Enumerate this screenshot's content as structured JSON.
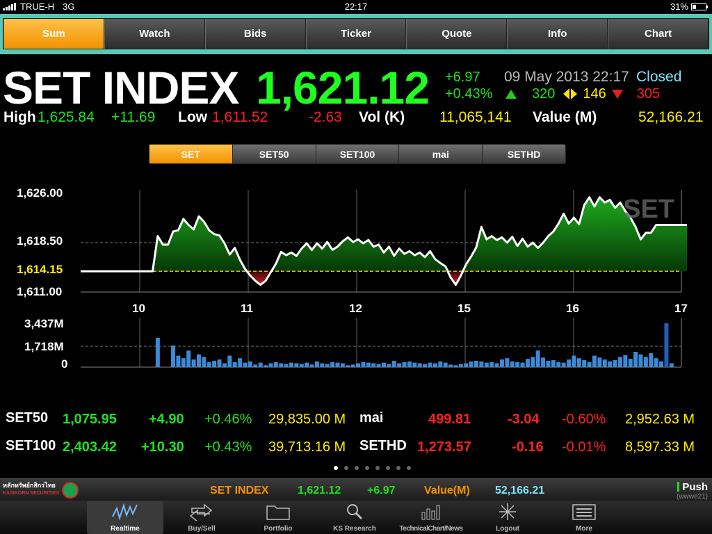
{
  "status": {
    "carrier": "TRUE-H",
    "network": "3G",
    "time": "22:17",
    "battery": "31%"
  },
  "tabs": [
    {
      "label": "Sum",
      "active": true
    },
    {
      "label": "Watch"
    },
    {
      "label": "Bids"
    },
    {
      "label": "Ticker"
    },
    {
      "label": "Quote"
    },
    {
      "label": "Info"
    },
    {
      "label": "Chart"
    }
  ],
  "header": {
    "name": "SET INDEX",
    "value": "1,621.12",
    "change": "+6.97",
    "change_pct": "+0.43%",
    "datetime": "09 May 2013 22:17",
    "market_status": "Closed",
    "advances": "320",
    "unchanged": "146",
    "declines": "305",
    "high_label": "High",
    "high": "1,625.84",
    "high_chg": "+11.69",
    "low_label": "Low",
    "low": "1,611.52",
    "low_chg": "-2.63",
    "vol_label": "Vol (K)",
    "vol": "11,065,141",
    "value_label": "Value (M)",
    "value_m": "52,166.21"
  },
  "subtabs": [
    {
      "label": "SET",
      "active": true
    },
    {
      "label": "SET50"
    },
    {
      "label": "SET100"
    },
    {
      "label": "mai"
    },
    {
      "label": "SETHD"
    }
  ],
  "chart_data": {
    "type": "line",
    "watermark": "SET",
    "y_ticks": [
      "1,626.00",
      "1,618.50",
      "1,614.15",
      "1,611.00"
    ],
    "prev_close": 1614.15,
    "ylim": [
      1611.0,
      1626.0
    ],
    "x_ticks": [
      "10",
      "11",
      "12",
      "15",
      "16",
      "17"
    ],
    "volume_ticks": [
      "3,437M",
      "1,718M",
      "0"
    ],
    "price": [
      1614.15,
      1614.15,
      1614.15,
      1614.15,
      1614.15,
      1614.15,
      1614.15,
      1614.15,
      1614.15,
      1614.15,
      1614.15,
      1614.15,
      1614.15,
      1614.15,
      1614.15,
      1619.5,
      1618.2,
      1618.2,
      1620.2,
      1620.4,
      1622.1,
      1621.2,
      1620.5,
      1622.5,
      1621.7,
      1620.4,
      1619.8,
      1619.6,
      1618.4,
      1616.7,
      1617.7,
      1615.9,
      1614.5,
      1613.5,
      1612.7,
      1612.1,
      1612.7,
      1614.0,
      1615.3,
      1617.1,
      1616.6,
      1617.0,
      1616.5,
      1617.6,
      1618.4,
      1617.4,
      1618.4,
      1617.6,
      1618.6,
      1617.4,
      1617.9,
      1618.7,
      1619.3,
      1618.6,
      1619.0,
      1618.4,
      1618.9,
      1617.9,
      1618.2,
      1617.0,
      1617.9,
      1616.5,
      1617.6,
      1616.8,
      1617.2,
      1616.6,
      1617.0,
      1616.3,
      1617.2,
      1616.0,
      1615.4,
      1614.9,
      1613.2,
      1612.1,
      1613.5,
      1615.2,
      1616.4,
      1617.8,
      1620.9,
      1619.0,
      1619.5,
      1618.9,
      1619.3,
      1618.5,
      1619.4,
      1618.0,
      1619.1,
      1617.9,
      1618.5,
      1617.7,
      1618.5,
      1619.5,
      1620.2,
      1621.4,
      1622.9,
      1621.4,
      1622.3,
      1621.3,
      1624.2,
      1625.4,
      1624.0,
      1625.4,
      1624.6,
      1625.0,
      1623.8,
      1624.6,
      1623.3,
      1622.3,
      1620.9,
      1619.0,
      1620.0,
      1620.0,
      1621.2,
      1621.2,
      1621.2,
      1621.2,
      1621.2,
      1621.2,
      1621.2
    ],
    "volume_scale": 3437,
    "volume": [
      0,
      0,
      0,
      0,
      0,
      0,
      0,
      0,
      0,
      0,
      0,
      0,
      0,
      0,
      0,
      2300,
      0,
      0,
      1700,
      900,
      700,
      1300,
      600,
      1000,
      800,
      400,
      500,
      600,
      300,
      900,
      400,
      700,
      350,
      450,
      200,
      350,
      150,
      300,
      400,
      300,
      250,
      350,
      300,
      250,
      350,
      200,
      450,
      300,
      250,
      400,
      350,
      300,
      150,
      200,
      300,
      400,
      350,
      300,
      250,
      350,
      250,
      500,
      300,
      400,
      450,
      350,
      300,
      250,
      350,
      300,
      450,
      350,
      200,
      150,
      250,
      300,
      450,
      500,
      450,
      350,
      400,
      300,
      600,
      700,
      450,
      400,
      350,
      650,
      800,
      1300,
      750,
      500,
      550,
      400,
      350,
      600,
      900,
      700,
      550,
      400,
      900,
      750,
      600,
      450,
      550,
      800,
      950,
      650,
      1200,
      1000,
      800,
      1100,
      700,
      450,
      3437,
      300,
      0,
      0,
      0,
      0
    ],
    "series": [
      {
        "name": "SET",
        "color": "#ffffff"
      }
    ]
  },
  "indices": [
    {
      "name": "SET50",
      "value": "1,075.95",
      "chg": "+4.90",
      "pct": "+0.46%",
      "val": "29,835.00",
      "unit": "M",
      "dir": "up"
    },
    {
      "name": "SET100",
      "value": "2,403.42",
      "chg": "+10.30",
      "pct": "+0.43%",
      "val": "39,713.16",
      "unit": "M",
      "dir": "up"
    },
    {
      "name": "mai",
      "value": "499.81",
      "chg": "-3.04",
      "pct": "-0.60%",
      "val": "2,952.63",
      "unit": "M",
      "dir": "down"
    },
    {
      "name": "SETHD",
      "value": "1,273.57",
      "chg": "-0.16",
      "pct": "-0.01%",
      "val": "8,597.33",
      "unit": "M",
      "dir": "down"
    }
  ],
  "ticker": {
    "brand_line1": "หลักทรัพย์กสิกรไทย",
    "brand_line2": "KASIKORN SECURITIES",
    "name": "SET INDEX",
    "value": "1,621.12",
    "change": "+6.97",
    "value_label": "Value(M)",
    "value_m": "52,166.21",
    "push": "Push",
    "push_code": "(wwwe21)"
  },
  "toolbar": [
    {
      "label": "Realtime",
      "icon": "pulse-icon",
      "active": true
    },
    {
      "label": "Buy/Sell",
      "icon": "swap-arrows-icon"
    },
    {
      "label": "Portfolio",
      "icon": "folder-icon"
    },
    {
      "label": "KS Research",
      "icon": "magnifier-icon"
    },
    {
      "label": "TechnicalChart/News",
      "icon": "bar-chart-icon"
    },
    {
      "label": "Logout",
      "icon": "logout-burst-icon"
    },
    {
      "label": "More",
      "icon": "list-icon"
    }
  ],
  "colors": {
    "accent": "#f39200",
    "up": "#20e020",
    "down": "#ff2020",
    "volume": "#3a8ad8",
    "closed": "#7fe6ff"
  }
}
